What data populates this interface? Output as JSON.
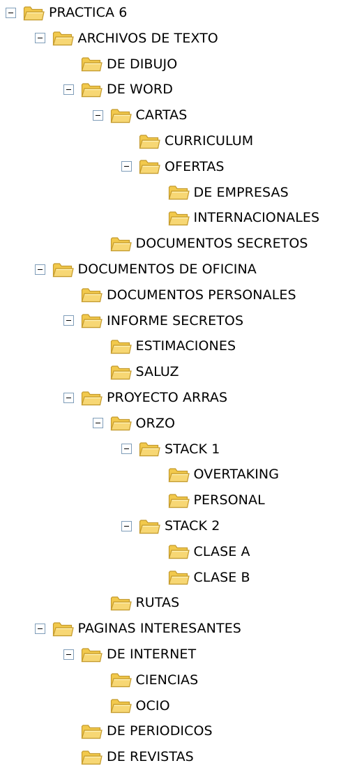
{
  "tree": {
    "nodes": [
      {
        "label": "PRACTICA 6",
        "level": 0,
        "expanded": true
      },
      {
        "label": "ARCHIVOS DE TEXTO",
        "level": 1,
        "expanded": true
      },
      {
        "label": "DE DIBUJO",
        "level": 2,
        "expanded": null
      },
      {
        "label": "DE WORD",
        "level": 2,
        "expanded": true
      },
      {
        "label": "CARTAS",
        "level": 3,
        "expanded": true
      },
      {
        "label": "CURRICULUM",
        "level": 4,
        "expanded": null
      },
      {
        "label": "OFERTAS",
        "level": 4,
        "expanded": true
      },
      {
        "label": "DE EMPRESAS",
        "level": 5,
        "expanded": null
      },
      {
        "label": "INTERNACIONALES",
        "level": 5,
        "expanded": null
      },
      {
        "label": "DOCUMENTOS SECRETOS",
        "level": 3,
        "expanded": null
      },
      {
        "label": "DOCUMENTOS DE OFICINA",
        "level": 1,
        "expanded": true
      },
      {
        "label": "DOCUMENTOS PERSONALES",
        "level": 2,
        "expanded": null
      },
      {
        "label": "INFORME SECRETOS",
        "level": 2,
        "expanded": true
      },
      {
        "label": "ESTIMACIONES",
        "level": 3,
        "expanded": null
      },
      {
        "label": "SALUZ",
        "level": 3,
        "expanded": null
      },
      {
        "label": "PROYECTO ARRAS",
        "level": 2,
        "expanded": true
      },
      {
        "label": "ORZO",
        "level": 3,
        "expanded": true
      },
      {
        "label": "STACK 1",
        "level": 4,
        "expanded": true
      },
      {
        "label": "OVERTAKING",
        "level": 5,
        "expanded": null
      },
      {
        "label": "PERSONAL",
        "level": 5,
        "expanded": null
      },
      {
        "label": "STACK 2",
        "level": 4,
        "expanded": true
      },
      {
        "label": "CLASE A",
        "level": 5,
        "expanded": null
      },
      {
        "label": "CLASE B",
        "level": 5,
        "expanded": null
      },
      {
        "label": "RUTAS",
        "level": 3,
        "expanded": null
      },
      {
        "label": "PAGINAS INTERESANTES",
        "level": 1,
        "expanded": true
      },
      {
        "label": "DE INTERNET",
        "level": 2,
        "expanded": true
      },
      {
        "label": "CIENCIAS",
        "level": 3,
        "expanded": null
      },
      {
        "label": "OCIO",
        "level": 3,
        "expanded": null
      },
      {
        "label": "DE PERIODICOS",
        "level": 2,
        "expanded": null
      },
      {
        "label": "DE REVISTAS",
        "level": 2,
        "expanded": null
      }
    ]
  },
  "colors": {
    "folder_body": "#f7d774",
    "folder_outline": "#c49a2c",
    "toggle_border": "#7f9db9"
  },
  "icons": {
    "folder": "folder-icon",
    "collapse": "collapse-toggle-icon"
  }
}
